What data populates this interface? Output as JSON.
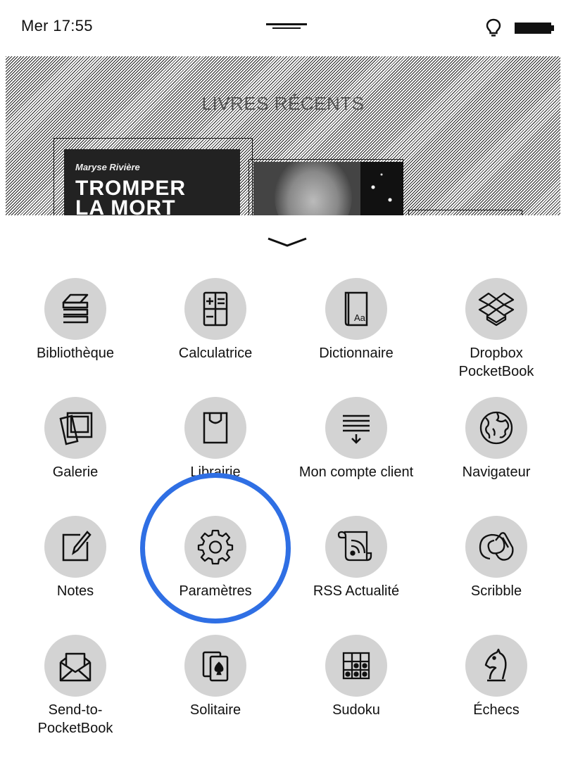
{
  "status_bar": {
    "time": "Mer 17:55",
    "icons": [
      "grabber-icon",
      "bulb-icon",
      "battery-icon"
    ]
  },
  "recent_books": {
    "title": "LIVRES RÉCENTS",
    "book1": {
      "author": "Maryse Rivière",
      "title_line1": "TROMPER",
      "title_line2": "LA MORT"
    }
  },
  "apps": [
    {
      "label": "Bibliothèque",
      "icon": "library-icon"
    },
    {
      "label": "Calculatrice",
      "icon": "calculator-icon"
    },
    {
      "label": "Dictionnaire",
      "icon": "dictionary-icon",
      "glyph": "Aa"
    },
    {
      "label": "Dropbox PocketBook",
      "line1": "Dropbox",
      "line2": "PocketBook",
      "icon": "dropbox-icon"
    },
    {
      "label": "Galerie",
      "icon": "gallery-icon"
    },
    {
      "label": "Librairie",
      "icon": "store-bag-icon"
    },
    {
      "label": "Mon compte client",
      "icon": "account-icon"
    },
    {
      "label": "Navigateur",
      "icon": "globe-icon"
    },
    {
      "label": "Notes",
      "icon": "notes-icon"
    },
    {
      "label": "Paramètres",
      "icon": "gear-icon"
    },
    {
      "label": "RSS Actualité",
      "icon": "rss-icon"
    },
    {
      "label": "Scribble",
      "icon": "scribble-icon"
    },
    {
      "label": "Send-to-PocketBook",
      "line1": "Send-to-",
      "line2": "PocketBook",
      "icon": "envelope-icon"
    },
    {
      "label": "Solitaire",
      "icon": "cards-icon"
    },
    {
      "label": "Sudoku",
      "icon": "sudoku-icon"
    },
    {
      "label": "Échecs",
      "icon": "chess-knight-icon"
    }
  ],
  "highlight": {
    "target": "Paramètres",
    "color": "#2f6fe4"
  },
  "colors": {
    "icon_circle": "#d3d3d3",
    "text": "#111111"
  }
}
